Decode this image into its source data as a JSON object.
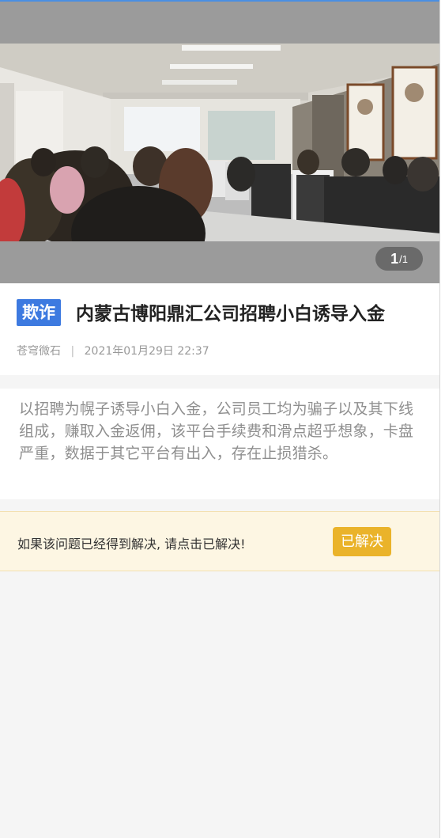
{
  "gallery": {
    "current": "1",
    "total": "/1",
    "image_alt": "classroom photo"
  },
  "post": {
    "category_badge": "欺诈",
    "title": "内蒙古博阳鼎汇公司招聘小白诱导入金",
    "author": "苍穹微石",
    "separator": "|",
    "datetime": "2021年01月29日 22:37",
    "description": "以招聘为幌子诱导小白入金，公司员工均为骗子以及其下线组成，赚取入金返佣，该平台手续费和滑点超乎想象，卡盘严重，数据于其它平台有出入，存在止损猎杀。"
  },
  "resolve": {
    "prompt": "如果该问题已经得到解决, 请点击已解决!",
    "button_label": "已解决"
  },
  "colors": {
    "badge": "#3d7ae0",
    "resolve_button": "#eab32a",
    "resolve_bg": "#fdf6e3"
  }
}
